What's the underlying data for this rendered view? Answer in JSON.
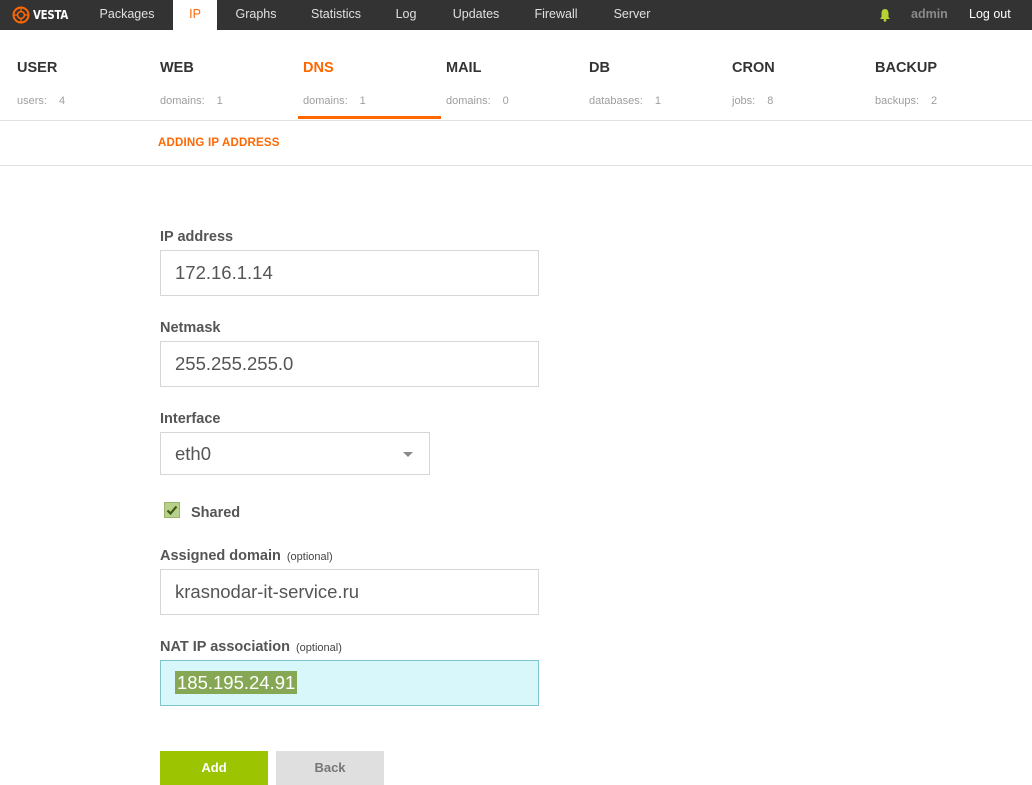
{
  "app": {
    "logo_text": "VESTA"
  },
  "topnav": {
    "items": [
      {
        "label": "Packages"
      },
      {
        "label": "IP"
      },
      {
        "label": "Graphs"
      },
      {
        "label": "Statistics"
      },
      {
        "label": "Log"
      },
      {
        "label": "Updates"
      },
      {
        "label": "Firewall"
      },
      {
        "label": "Server"
      }
    ],
    "active": "IP",
    "user": "admin",
    "logout": "Log out"
  },
  "tabs": [
    {
      "title": "USER",
      "stat_label": "users:",
      "stat_value": "4"
    },
    {
      "title": "WEB",
      "stat_label": "domains:",
      "stat_value": "1"
    },
    {
      "title": "DNS",
      "stat_label": "domains:",
      "stat_value": "1"
    },
    {
      "title": "MAIL",
      "stat_label": "domains:",
      "stat_value": "0"
    },
    {
      "title": "DB",
      "stat_label": "databases:",
      "stat_value": "1"
    },
    {
      "title": "CRON",
      "stat_label": "jobs:",
      "stat_value": "8"
    },
    {
      "title": "BACKUP",
      "stat_label": "backups:",
      "stat_value": "2"
    }
  ],
  "active_tab": "DNS",
  "page_title": "ADDING IP ADDRESS",
  "form": {
    "ip_label": "IP address",
    "ip_value": "172.16.1.14",
    "netmask_label": "Netmask",
    "netmask_value": "255.255.255.0",
    "interface_label": "Interface",
    "interface_value": "eth0",
    "shared_label": "Shared",
    "shared_checked": true,
    "domain_label": "Assigned domain",
    "domain_optional": "(optional)",
    "domain_value": "krasnodar-it-service.ru",
    "nat_label": "NAT IP association",
    "nat_optional": "(optional)",
    "nat_value": "185.195.24.91"
  },
  "buttons": {
    "add": "Add",
    "back": "Back"
  },
  "colors": {
    "accent": "#ff6701",
    "topbar": "#333333",
    "add_button": "#9dc400",
    "focus_field": "#d7f7fb"
  }
}
